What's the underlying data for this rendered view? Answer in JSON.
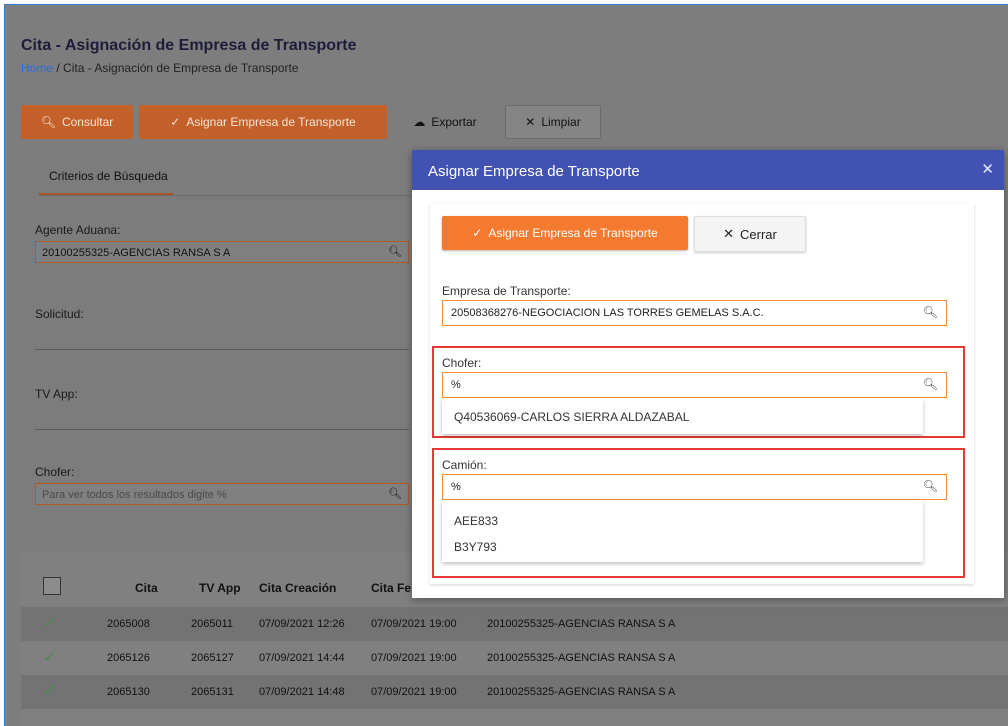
{
  "page": {
    "title": "Cita - Asignación de Empresa de Transporte",
    "breadcrumb_home": "Home",
    "breadcrumb_sep": "/",
    "breadcrumb_current": "Cita - Asignación de Empresa de Transporte"
  },
  "toolbar": {
    "consultar": "Consultar",
    "asignar": "Asignar Empresa de Transporte",
    "exportar": "Exportar",
    "limpiar": "Limpiar"
  },
  "filters": {
    "tab": "Criterios de Búsqueda",
    "agente_label": "Agente Aduana:",
    "agente_value": "20100255325-AGENCIAS RANSA S A",
    "solicitud_label": "Solicitud:",
    "tvapp_label": "TV App:",
    "chofer_label": "Chofer:",
    "chofer_placeholder": "Para ver todos los resultados digite %"
  },
  "table": {
    "headers": [
      "Cita",
      "TV App",
      "Cita Creación",
      "Cita Fe"
    ],
    "rows": [
      {
        "cita": "2065008",
        "tvapp": "2065011",
        "creacion": "07/09/2021 12:26",
        "fecha": "07/09/2021 19:00",
        "agente": "20100255325-AGENCIAS RANSA S A"
      },
      {
        "cita": "2065126",
        "tvapp": "2065127",
        "creacion": "07/09/2021 14:44",
        "fecha": "07/09/2021 19:00",
        "agente": "20100255325-AGENCIAS RANSA S A"
      },
      {
        "cita": "2065130",
        "tvapp": "2065131",
        "creacion": "07/09/2021 14:48",
        "fecha": "07/09/2021 19:00",
        "agente": "20100255325-AGENCIAS RANSA S A"
      }
    ]
  },
  "modal": {
    "title": "Asignar Empresa de Transporte",
    "close": "✕",
    "primary": "Asignar Empresa de Transporte",
    "secondary": "Cerrar",
    "empresa_label": "Empresa de Transporte:",
    "empresa_value": "20508368276-NEGOCIACION LAS TORRES GEMELAS S.A.C.",
    "chofer_label": "Chofer:",
    "chofer_value": "%",
    "chofer_options": [
      "Q40536069-CARLOS SIERRA ALDAZABAL"
    ],
    "camion_label": "Camión:",
    "camion_value": "%",
    "camion_options": [
      "AEE833",
      "B3Y793"
    ]
  },
  "colors": {
    "accent_orange": "#f47a30",
    "modal_header": "#4152b3",
    "highlight_red": "#e53935"
  }
}
